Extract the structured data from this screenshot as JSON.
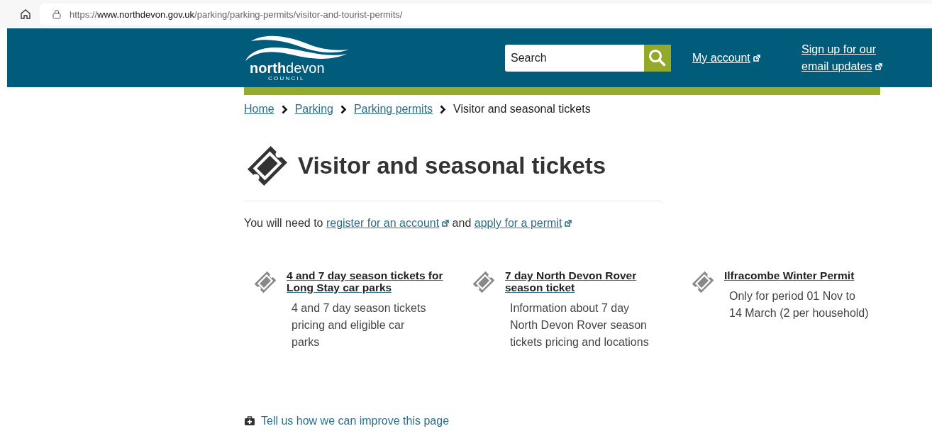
{
  "browser": {
    "url": {
      "scheme": "https://",
      "host": "www.northdevon.gov.uk",
      "path": "/parking/parking-permits/visitor-and-tourist-permits/"
    }
  },
  "header": {
    "logo": {
      "bold": "north",
      "rest": "devon",
      "subtitle": "C O U N C I L"
    },
    "search": {
      "placeholder": "Search"
    },
    "links": [
      {
        "label": "My account"
      },
      {
        "label": "Sign up for our email updates"
      }
    ]
  },
  "breadcrumbs": [
    {
      "label": "Home",
      "current": false
    },
    {
      "label": "Parking",
      "current": false
    },
    {
      "label": "Parking permits",
      "current": false
    },
    {
      "label": "Visitor and seasonal tickets",
      "current": true
    }
  ],
  "page": {
    "title": "Visitor and seasonal tickets",
    "intro": [
      {
        "kind": "text",
        "text": "You will need to "
      },
      {
        "kind": "link",
        "text": "register for an account"
      },
      {
        "kind": "text",
        "text": " and "
      },
      {
        "kind": "link",
        "text": "apply for a permit"
      }
    ]
  },
  "cards": [
    {
      "title": "4 and 7 day season tickets for Long Stay car parks",
      "description": "4 and 7 day season tickets pricing and eligible car parks"
    },
    {
      "title": "7 day North Devon Rover season ticket",
      "description": "Information about 7 day North Devon Rover season tickets pricing and locations"
    },
    {
      "title": "Ilfracombe Winter Permit",
      "description": "Only for period 01 Nov to 14 March (2 per household)"
    }
  ],
  "feedback": {
    "label": "Tell us how we can improve this page"
  }
}
